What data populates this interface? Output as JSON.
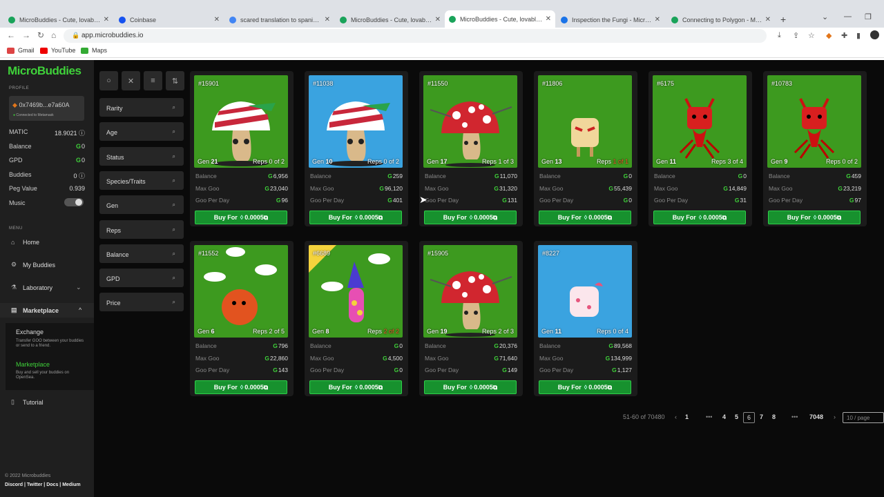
{
  "browser": {
    "tabs": [
      {
        "title": "MicroBuddies - Cute, lovable, sn",
        "color": "#1aa35a"
      },
      {
        "title": "Coinbase",
        "color": "#1652f0"
      },
      {
        "title": "scared translation to spanish - S",
        "color": "#4285f4"
      },
      {
        "title": "MicroBuddies - Cute, lovable, sn",
        "color": "#1aa35a"
      },
      {
        "title": "MicroBuddies - Cute, lovable, sn",
        "color": "#1aa35a"
      },
      {
        "title": "Inspection the Fungi - MicroBud",
        "color": "#1a73e8"
      },
      {
        "title": "Connecting to Polygon - MicroB",
        "color": "#1aa35a"
      }
    ],
    "url": "app.microbuddies.io",
    "bookmarks": [
      "Gmail",
      "YouTube",
      "Maps"
    ]
  },
  "sidebar": {
    "logo": "MicroBuddies",
    "profile_label": "PROFILE",
    "wallet": "0x7469b...e7a60A",
    "wallet_status": "Connected to Metamask",
    "stats": [
      {
        "label": "MATIC",
        "value": "18.9021"
      },
      {
        "label": "Balance",
        "value": "0"
      },
      {
        "label": "GPD",
        "value": "0"
      },
      {
        "label": "Buddies",
        "value": "0"
      },
      {
        "label": "Peg Value",
        "value": "0.939"
      },
      {
        "label": "Music",
        "value": ""
      }
    ],
    "menu_label": "MENU",
    "menu": [
      {
        "label": "Home",
        "icon": "home-icon"
      },
      {
        "label": "My Buddies",
        "icon": "gear-icon"
      },
      {
        "label": "Laboratory",
        "icon": "flask-icon"
      },
      {
        "label": "Marketplace",
        "icon": "shop-icon"
      }
    ],
    "submenu": [
      {
        "title": "Exchange",
        "desc": "Transfer GOO between your buddies or send to a friend."
      },
      {
        "title": "Marketplace",
        "desc": "Buy and sell your buddies on OpenSea."
      }
    ],
    "tutorial": "Tutorial",
    "copyright": "© 2022 Microbuddies",
    "links": [
      "Discord",
      "Twitter",
      "Docs",
      "Medium"
    ]
  },
  "filters": [
    "Rarity",
    "Age",
    "Status",
    "Species/Traits",
    "Gen",
    "Reps",
    "Balance",
    "GPD",
    "Price"
  ],
  "labels": {
    "balance": "Balance",
    "max_goo": "Max Goo",
    "goo_per_day": "Goo Per Day",
    "buy": "Buy For",
    "price": "0.0005",
    "gen": "Gen",
    "reps": "Reps"
  },
  "cards": [
    {
      "id": "#15901",
      "gen": "21",
      "reps": "0 of 2",
      "balance": "6,956",
      "max_goo": "23,040",
      "gpd": "96",
      "bg": "#3d9a1f",
      "creature": "mushroom-striped",
      "reps_alert": false
    },
    {
      "id": "#11038",
      "gen": "10",
      "reps": "0 of 2",
      "balance": "259",
      "max_goo": "96,120",
      "gpd": "401",
      "bg": "#3aa3e0",
      "creature": "mushroom-striped",
      "reps_alert": false
    },
    {
      "id": "#11550",
      "gen": "17",
      "reps": "1 of 3",
      "balance": "11,070",
      "max_goo": "31,320",
      "gpd": "131",
      "bg": "#3d9a1f",
      "creature": "mushroom-red",
      "reps_alert": false
    },
    {
      "id": "#11806",
      "gen": "13",
      "reps": "1 of 1",
      "balance": "0",
      "max_goo": "55,439",
      "gpd": "0",
      "bg": "#3d9a1f",
      "creature": "toast",
      "reps_alert": true
    },
    {
      "id": "#6175",
      "gen": "11",
      "reps": "3 of 4",
      "balance": "0",
      "max_goo": "14,849",
      "gpd": "31",
      "bg": "#3d9a1f",
      "creature": "devil",
      "reps_alert": false
    },
    {
      "id": "#10783",
      "gen": "9",
      "reps": "0 of 2",
      "balance": "459",
      "max_goo": "23,219",
      "gpd": "97",
      "bg": "#3d9a1f",
      "creature": "devil",
      "reps_alert": false
    },
    {
      "id": "#11552",
      "gen": "6",
      "reps": "2 of 5",
      "balance": "796",
      "max_goo": "22,860",
      "gpd": "143",
      "bg": "#3d9a1f",
      "creature": "fuzzball",
      "reps_alert": false
    },
    {
      "id": "#6689",
      "gen": "8",
      "reps": "2 of 2",
      "balance": "0",
      "max_goo": "4,500",
      "gpd": "0",
      "bg": "#3d9a1f",
      "creature": "wizard",
      "reps_alert": true
    },
    {
      "id": "#15905",
      "gen": "19",
      "reps": "2 of 3",
      "balance": "20,376",
      "max_goo": "71,640",
      "gpd": "149",
      "bg": "#3d9a1f",
      "creature": "mushroom-red",
      "reps_alert": false
    },
    {
      "id": "#8227",
      "gen": "11",
      "reps": "0 of 4",
      "balance": "89,568",
      "max_goo": "134,999",
      "gpd": "1,127",
      "bg": "#3aa3e0",
      "creature": "marshmallow",
      "reps_alert": false
    }
  ],
  "pagination": {
    "range": "51-60 of 70480",
    "pages": [
      "1",
      "•••",
      "4",
      "5",
      "6",
      "7",
      "8",
      "•••",
      "7048"
    ],
    "active": "6",
    "page_size": "10 / page"
  }
}
